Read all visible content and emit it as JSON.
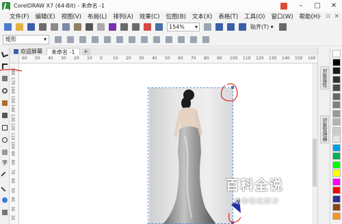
{
  "window": {
    "title": "CorelDRAW X7 (64-Bit) - 未命名 -1"
  },
  "menu": {
    "items": [
      "文件(F)",
      "编辑(E)",
      "视图(V)",
      "布局(L)",
      "排列(A)",
      "效果(C)",
      "位图(B)",
      "文本(X)",
      "表格(T)",
      "工具(O)",
      "窗口(W)",
      "帮助(H)"
    ]
  },
  "standard_toolbar": {
    "zoom_level": "154%",
    "snap_label": "贴齐(T)"
  },
  "property_bar": {
    "tool_name": "矩形"
  },
  "tabs": [
    {
      "label": "欢迎屏幕"
    },
    {
      "label": "未命名 -1"
    }
  ],
  "ruler": {
    "top_labels": [
      "60",
      "50",
      "40",
      "30",
      "20",
      "10",
      "0",
      "10",
      "20",
      "30",
      "40",
      "50",
      "60",
      "70",
      "80",
      "90",
      "100",
      "110",
      "120",
      "130",
      "140",
      "150",
      "160"
    ],
    "left_labels": [
      "180",
      "170",
      "160",
      "150",
      "140",
      "130",
      "120",
      "110",
      "100",
      "90",
      "80",
      "70",
      "60",
      "50",
      "40",
      "30",
      "20"
    ]
  },
  "docker": {
    "tabs": [
      "对象属性",
      "对象管理器"
    ]
  },
  "palette": {
    "colors": [
      "#ffffff",
      "#000000",
      "#1a1a1a",
      "#333333",
      "#4d4d4d",
      "#666666",
      "#808080",
      "#999999",
      "#b3b3b3",
      "#cccccc",
      "#e6e6e6",
      "#00a0e9",
      "#00b050",
      "#00ff00",
      "#ffff00",
      "#ff00ff",
      "#ff0000",
      "#2e3192",
      "#8b4513",
      "#f7941d"
    ]
  },
  "watermark": {
    "title": "百科全说",
    "subtitle": "助你轻松解决"
  }
}
